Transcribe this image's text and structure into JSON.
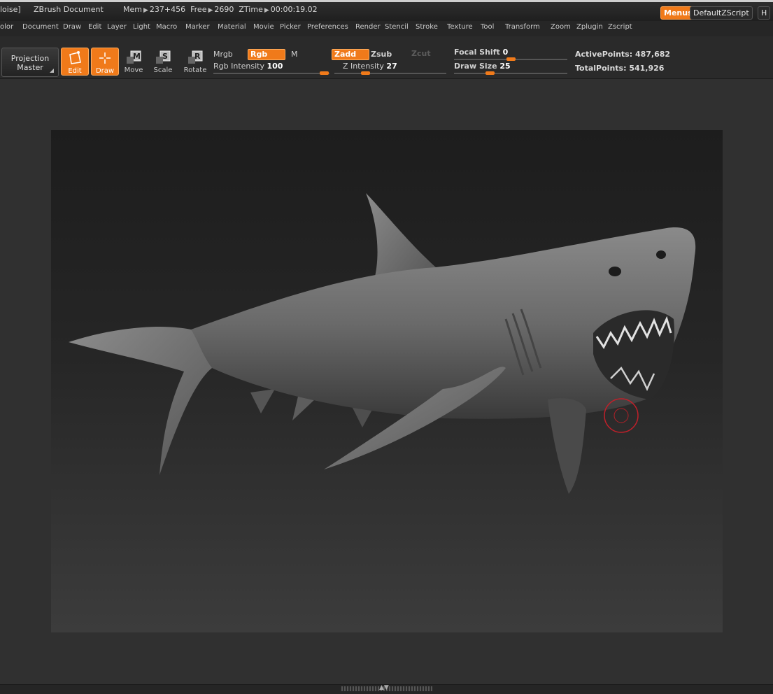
{
  "titlebar": {
    "doc_frag": "loise]",
    "app": "ZBrush Document",
    "mem_label": "Mem",
    "mem_value": "237+456",
    "free_label": "Free",
    "free_value": "2690",
    "ztime_label": "ZTime",
    "ztime_value": "00:00:19.02",
    "menus_btn": "Menus",
    "script_btn": "DefaultZScript",
    "h_btn": "H"
  },
  "menubar": [
    "olor",
    "Document",
    "Draw",
    "Edit",
    "Layer",
    "Light",
    "Macro",
    "Marker",
    "Material",
    "Movie",
    "Picker",
    "Preferences",
    "Render",
    "Stencil",
    "Stroke",
    "Texture",
    "Tool",
    "Transform",
    "Zoom",
    "Zplugin",
    "Zscript"
  ],
  "toolbar": {
    "projection_line1": "Projection",
    "projection_line2": "Master",
    "tools": {
      "edit": "Edit",
      "draw": "Draw",
      "move": "Move",
      "scale": "Scale",
      "rotate": "Rotate"
    },
    "mrgb": "Mrgb",
    "rgb": "Rgb",
    "m": "M",
    "rgb_intensity_label": "Rgb  Intensity",
    "rgb_intensity_value": "100",
    "zadd": "Zadd",
    "zsub": "Zsub",
    "zcut": "Zcut",
    "z_intensity_label": "Z  Intensity",
    "z_intensity_value": "27",
    "focal_shift_label": "Focal  Shift",
    "focal_shift_value": "0",
    "draw_size_label": "Draw  Size",
    "draw_size_value": "25",
    "active_points_label": "ActivePoints:",
    "active_points_value": "487,682",
    "total_points_label": "TotalPoints:",
    "total_points_value": "541,926"
  },
  "colors": {
    "accent": "#f07a1a",
    "brush_cursor": "#c0202a"
  }
}
